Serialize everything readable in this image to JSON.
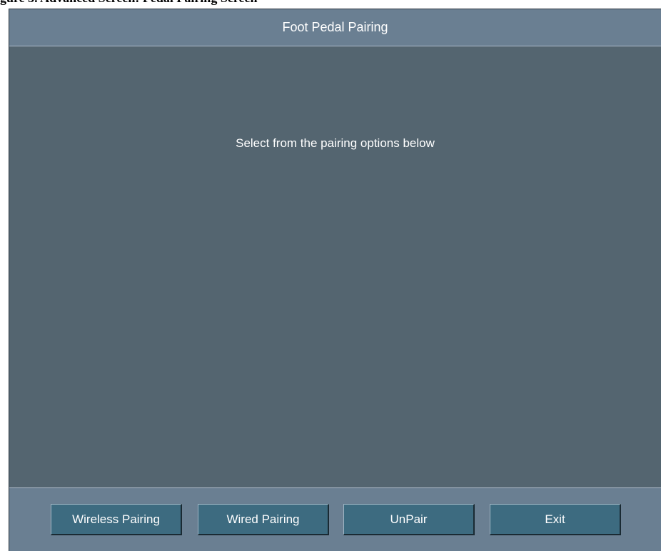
{
  "caption": "gure 3.  Advanced Screen: Pedal Pairing Screen",
  "window": {
    "title": "Foot Pedal Pairing"
  },
  "main": {
    "message": "Select from the pairing options below"
  },
  "footer": {
    "buttons": {
      "wireless": "Wireless Pairing",
      "wired": "Wired Pairing",
      "unpair": "UnPair",
      "exit": "Exit"
    }
  },
  "colors": {
    "title_bar": "#6a7f92",
    "background": "#546570",
    "button": "#3d6b80",
    "text": "#ffffff"
  }
}
